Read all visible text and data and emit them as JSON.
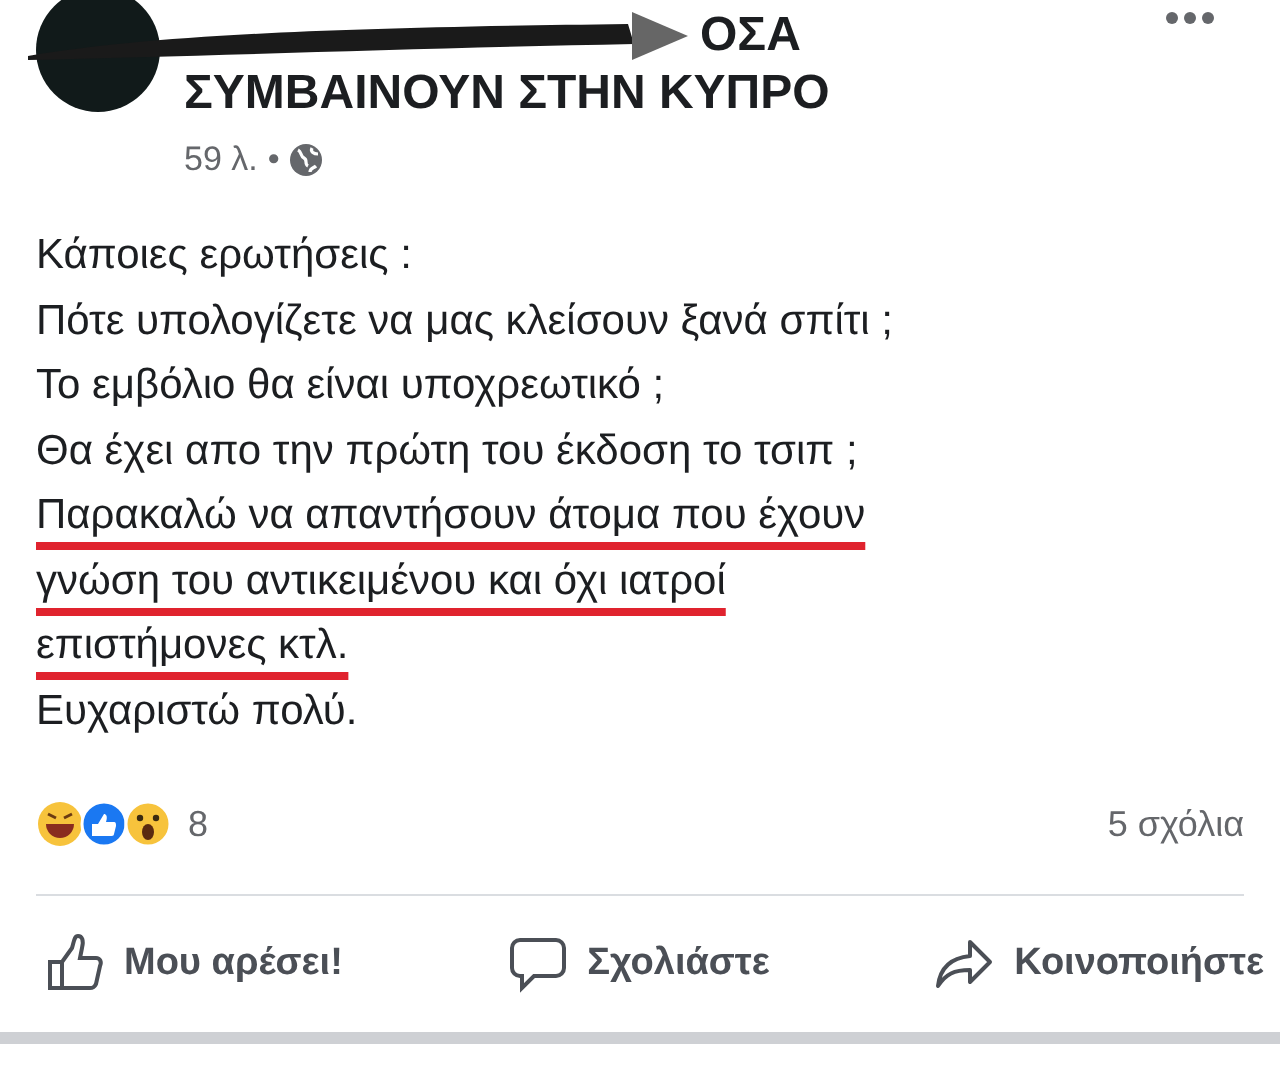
{
  "post": {
    "title_lines": [
      "ΟΣΑ",
      "ΣΥΜΒΑΙΝΟΥΝ ΣΤΗΝ ΚΥΠΡΟ"
    ],
    "time": "59 λ.",
    "separator": "•",
    "body": [
      {
        "text": "Κάποιες ερωτήσεις :",
        "underlined": false
      },
      {
        "text": "Πότε υπολογίζετε να μας κλείσουν ξανά σπίτι ;",
        "underlined": false
      },
      {
        "text": "Το εμβόλιο θα είναι υποχρεωτικό ;",
        "underlined": false
      },
      {
        "text": "Θα έχει απο την πρώτη του έκδοση το τσιπ ;",
        "underlined": false
      },
      {
        "text": "Παρακαλώ να απαντήσουν άτομα που έχουν",
        "underlined": true
      },
      {
        "text": "γνώση του αντικειμένου και όχι ιατροί",
        "underlined": true
      },
      {
        "text": "επιστήμονες κτλ.",
        "underlined": true
      },
      {
        "text": "Ευχαριστώ πολύ.",
        "underlined": false
      }
    ],
    "reaction_count": "8",
    "comments": "5 σχόλια",
    "actions": [
      {
        "kind": "like",
        "label": "Μου αρέσει!"
      },
      {
        "kind": "comment",
        "label": "Σχολιάστε"
      },
      {
        "kind": "share",
        "label": "Κοινοποιήστε"
      }
    ]
  }
}
